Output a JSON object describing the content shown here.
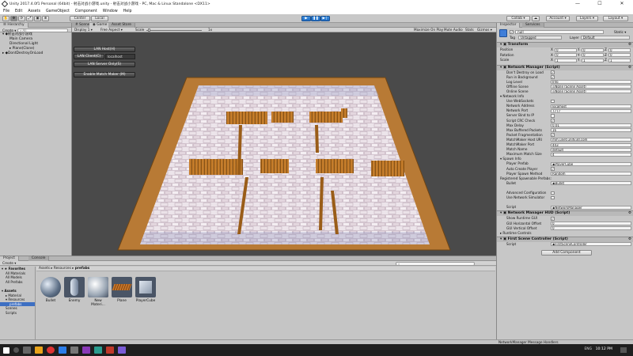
{
  "window": {
    "title": "Unity 2017.4.0f1 Personal (64bit) - 射击对战小游戏.unity - 射击对战小游戏 - PC, Mac & Linux Standalone <DX11>"
  },
  "menu": [
    "File",
    "Edit",
    "Assets",
    "GameObject",
    "Component",
    "Window",
    "Help"
  ],
  "toolbar": {
    "center": "Center",
    "local": "Local",
    "collab": "Collab ▾",
    "account": "Account ▾",
    "layers": "Layers ▾",
    "layout": "Layout ▾"
  },
  "hierarchy": {
    "tab": "Hierarchy",
    "create": "Create ▾",
    "search_placeholder": "All",
    "items": [
      {
        "label": "▾ ◆射击对战小游戏",
        "indent": 0
      },
      {
        "label": "Main Camera",
        "indent": 1
      },
      {
        "label": "Directional Light",
        "indent": 1
      },
      {
        "label": "▸ Plane(Clone)",
        "indent": 1
      },
      {
        "label": "▸ ◆DontDestroyOnLoad",
        "indent": 0
      }
    ]
  },
  "scene": {
    "tabs": [
      "# Scene",
      "◉ Game",
      "Asset Store"
    ],
    "display": "Display 1 ▾",
    "aspect": "Free Aspect ▾",
    "scale_label": "Scale",
    "scale_value": "1x",
    "toggles": [
      "Maximize On Play",
      "Mute Audio",
      "Stats",
      "Gizmos ▾"
    ]
  },
  "lan": {
    "host": "LAN Host(H)",
    "client": "LAN Client(C)",
    "client_addr": "localhost",
    "server": "LAN Server Only(S)",
    "matchmaker": "Enable Match Maker (M)"
  },
  "inspector": {
    "tabs": [
      "Inspector",
      "Services"
    ],
    "object_name": "null",
    "static": "Static ▾",
    "tag_label": "Tag",
    "tag_value": "Untagged",
    "layer_label": "Layer",
    "layer_value": "Default",
    "transform": {
      "title": "Transform",
      "rows": [
        {
          "label": "Position",
          "x": "0",
          "y": "0",
          "z": "0"
        },
        {
          "label": "Rotation",
          "x": "0",
          "y": "0",
          "z": "0"
        },
        {
          "label": "Scale",
          "x": "1",
          "y": "1",
          "z": "1"
        }
      ]
    },
    "network_manager": {
      "title": "Network Manager (Script)",
      "rows": [
        {
          "label": "Don't Destroy on Load",
          "type": "check",
          "value": "✓"
        },
        {
          "label": "Run in Background",
          "type": "check",
          "value": "✓"
        },
        {
          "label": "Log Level",
          "type": "field",
          "value": "Info"
        },
        {
          "label": "Offline Scene",
          "type": "field",
          "value": "◎None (Scene Asset)"
        },
        {
          "label": "Online Scene",
          "type": "field",
          "value": "◎None (Scene Asset)"
        },
        {
          "label": "▾ Network Info",
          "type": "section",
          "value": ""
        },
        {
          "label": "Use WebSockets",
          "type": "check",
          "value": ""
        },
        {
          "label": "Network Address",
          "type": "field",
          "value": "localhost"
        },
        {
          "label": "Network Port",
          "type": "field",
          "value": "7777"
        },
        {
          "label": "Server Bind to IP",
          "type": "check",
          "value": ""
        },
        {
          "label": "Script CRC Check",
          "type": "check",
          "value": "✓"
        },
        {
          "label": "Max Delay",
          "type": "field",
          "value": "0.01"
        },
        {
          "label": "Max Buffered Packets",
          "type": "field",
          "value": "16"
        },
        {
          "label": "Packet Fragmentation",
          "type": "check",
          "value": "✓"
        },
        {
          "label": "MatchMaker Host URI",
          "type": "field",
          "value": "mm.unet.unity3d.com"
        },
        {
          "label": "MatchMaker Port",
          "type": "field",
          "value": "443"
        },
        {
          "label": "Match Name",
          "type": "field",
          "value": "default"
        },
        {
          "label": "Maximum Match Size",
          "type": "field",
          "value": "4"
        },
        {
          "label": "▾ Spawn Info",
          "type": "section",
          "value": ""
        },
        {
          "label": "Player Prefab",
          "type": "field",
          "value": "◉PlayerCube"
        },
        {
          "label": "Auto Create Player",
          "type": "check",
          "value": "✓"
        },
        {
          "label": "Player Spawn Method",
          "type": "field",
          "value": "Random"
        },
        {
          "label": "Registered Spawnable Prefabs:",
          "type": "section",
          "value": ""
        },
        {
          "label": "Bullet",
          "type": "field",
          "value": "◉Bullet"
        },
        {
          "label": "",
          "type": "spacer",
          "value": ""
        },
        {
          "label": "Advanced Configuration",
          "type": "check",
          "value": ""
        },
        {
          "label": "Use Network Simulator",
          "type": "check",
          "value": ""
        },
        {
          "label": "",
          "type": "spacer",
          "value": ""
        },
        {
          "label": "Script",
          "type": "field",
          "value": "◉NetworkManager"
        }
      ]
    },
    "hud": {
      "title": "Network Manager HUD (Script)",
      "rows": [
        {
          "label": "Show Runtime GUI",
          "type": "check",
          "value": "✓"
        },
        {
          "label": "GUI Horizontal Offset",
          "type": "field",
          "value": "0"
        },
        {
          "label": "GUI Vertical Offset",
          "type": "field",
          "value": "0"
        },
        {
          "label": "▸ Runtime Controls",
          "type": "section",
          "value": ""
        }
      ]
    },
    "controller": {
      "title": "First Scene Controller (Script)",
      "rows": [
        {
          "label": "Script",
          "type": "field",
          "value": "◉FirstSceneController"
        }
      ]
    },
    "add_component": "Add Component",
    "footer": "NetworkManager Message Handlers"
  },
  "project": {
    "tabs": [
      "Project",
      "Console"
    ],
    "create": "Create ▾",
    "tree": [
      {
        "label": "▾ ★ Favorites",
        "indent": 0,
        "bold": true
      },
      {
        "label": "All Materials",
        "indent": 1
      },
      {
        "label": "All Models",
        "indent": 1
      },
      {
        "label": "All Prefabs",
        "indent": 1
      },
      {
        "label": "",
        "indent": 0
      },
      {
        "label": "▾ Assets",
        "indent": 0,
        "bold": true
      },
      {
        "label": "▸ Material",
        "indent": 1
      },
      {
        "label": "▾ Resources",
        "indent": 1
      },
      {
        "label": "prefabs",
        "indent": 2,
        "selected": true
      },
      {
        "label": "Scenes",
        "indent": 1
      },
      {
        "label": "Scripts",
        "indent": 1
      }
    ],
    "breadcrumb": [
      "Assets",
      "Resources",
      "prefabs"
    ],
    "assets": [
      {
        "label": "Bullet",
        "icon": "sphere-icon"
      },
      {
        "label": "Enemy",
        "icon": "capsule-icon"
      },
      {
        "label": "New Materi...",
        "icon": "material-icon"
      },
      {
        "label": "Plane",
        "icon": "plane-icon"
      },
      {
        "label": "PlayerCube",
        "icon": "cube-icon"
      }
    ]
  },
  "taskbar": {
    "time": "10:12 PM",
    "lang": "ENG"
  }
}
